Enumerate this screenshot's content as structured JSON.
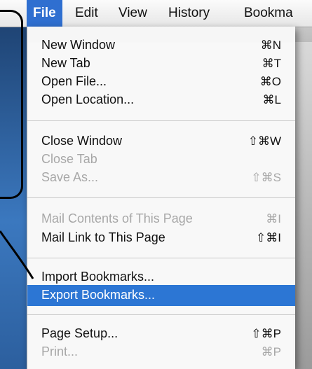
{
  "menubar": {
    "items": [
      {
        "label": "File",
        "active": true
      },
      {
        "label": "Edit"
      },
      {
        "label": "View"
      },
      {
        "label": "History"
      },
      {
        "label": "Bookma"
      }
    ]
  },
  "file_menu": {
    "items": [
      {
        "label": "New Window",
        "shortcut": "⌘N",
        "enabled": true
      },
      {
        "label": "New Tab",
        "shortcut": "⌘T",
        "enabled": true
      },
      {
        "label": "Open File...",
        "shortcut": "⌘O",
        "enabled": true
      },
      {
        "label": "Open Location...",
        "shortcut": "⌘L",
        "enabled": true
      },
      {
        "label": "Close Window",
        "shortcut": "⇧⌘W",
        "enabled": true
      },
      {
        "label": "Close Tab",
        "shortcut": "",
        "enabled": false
      },
      {
        "label": "Save As...",
        "shortcut": "⇧⌘S",
        "enabled": false
      },
      {
        "label": "Mail Contents of This Page",
        "shortcut": "⌘I",
        "enabled": false
      },
      {
        "label": "Mail Link to This Page",
        "shortcut": "⇧⌘I",
        "enabled": true
      },
      {
        "label": "Import Bookmarks...",
        "shortcut": "",
        "enabled": true
      },
      {
        "label": "Export Bookmarks...",
        "shortcut": "",
        "enabled": true,
        "highlighted": true
      },
      {
        "label": "Page Setup...",
        "shortcut": "⇧⌘P",
        "enabled": true
      },
      {
        "label": "Print...",
        "shortcut": "⌘P",
        "enabled": false
      }
    ]
  },
  "colors": {
    "highlight": "#2c76d4",
    "menubar_active": "#2f6fd0",
    "disabled_text": "#a7a7a7"
  }
}
